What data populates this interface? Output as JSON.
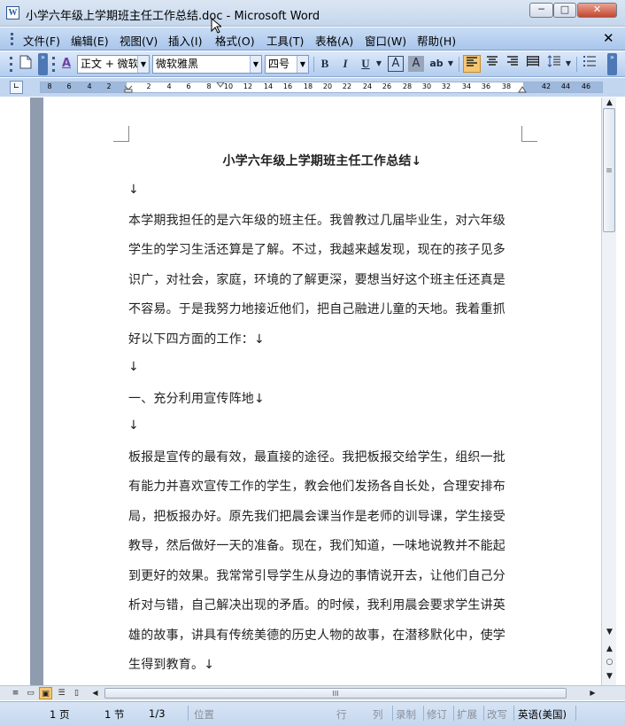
{
  "window": {
    "title": "小学六年级上学期班主任工作总结.doc - Microsoft Word",
    "app_icon": "W",
    "minimize_glyph": "─",
    "maximize_glyph": "□",
    "close_glyph": "✕"
  },
  "menu": {
    "items": [
      "文件(F)",
      "编辑(E)",
      "视图(V)",
      "插入(I)",
      "格式(O)",
      "工具(T)",
      "表格(A)",
      "窗口(W)",
      "帮助(H)"
    ],
    "close_glyph": "✕"
  },
  "toolbar": {
    "style_value": "正文 + 微软",
    "font_value": "微软雅黑",
    "size_value": "四号",
    "bold": "B",
    "italic": "I",
    "underline": "U",
    "char_border": "A",
    "char_shading": "A",
    "style_icon": "A",
    "highlight": "ab",
    "chevron": "»",
    "active_alignment": "align-left",
    "accent_color": "#f6c670"
  },
  "ruler": {
    "ticks": [
      "8",
      "6",
      "4",
      "2",
      "2",
      "4",
      "6",
      "8",
      "10",
      "12",
      "14",
      "16",
      "18",
      "20",
      "22",
      "24",
      "26",
      "28",
      "30",
      "32",
      "34",
      "36",
      "38",
      "42",
      "44",
      "46"
    ],
    "corner_glyph": "∟"
  },
  "document": {
    "title": "小学六年级上学期班主任工作总结↓",
    "lines": [
      "↓",
      "本学期我担任的是六年级的班主任。我曾教过几届毕业生，对六年级",
      "学生的学习生活还算是了解。不过，我越来越发现，现在的孩子见多",
      "识广，对社会，家庭，环境的了解更深，要想当好这个班主任还真是",
      "不容易。于是我努力地接近他们，把自己融进儿童的天地。我着重抓",
      "好以下四方面的工作：↓",
      "↓",
      "一、充分利用宣传阵地↓",
      "↓",
      "板报是宣传的最有效，最直接的途径。我把板报交给学生，组织一批",
      "有能力并喜欢宣传工作的学生，教会他们发扬各自长处，合理安排布",
      "局，把板报办好。原先我们把晨会课当作是老师的训导课，学生接受",
      "教导，然后做好一天的准备。现在，我们知道，一味地说教并不能起",
      "到更好的效果。我常常引导学生从身边的事情说开去，让他们自己分",
      "析对与错，自己解决出现的矛盾。的时候，我利用晨会要求学生讲英",
      "雄的故事，讲具有传统美德的历史人物的故事，在潜移默化中，使学",
      "生得到教育。↓"
    ]
  },
  "scrollbar": {
    "up": "▲",
    "down": "▼",
    "grip": "≡",
    "prev_page": "▲",
    "browse": "○",
    "next_page": "▼",
    "left": "◀",
    "right": "▶",
    "hgrip": "III"
  },
  "views": {
    "normal": "≡",
    "web": "▭",
    "print": "▣",
    "outline": "☰",
    "reading": "▯"
  },
  "status": {
    "page": "1 页",
    "section": "1 节",
    "page_of": "1/3",
    "position": "位置",
    "line": "行",
    "column": "列",
    "rec": "录制",
    "trk": "修订",
    "ext": "扩展",
    "ovr": "改写",
    "language": "英语(美国)"
  }
}
